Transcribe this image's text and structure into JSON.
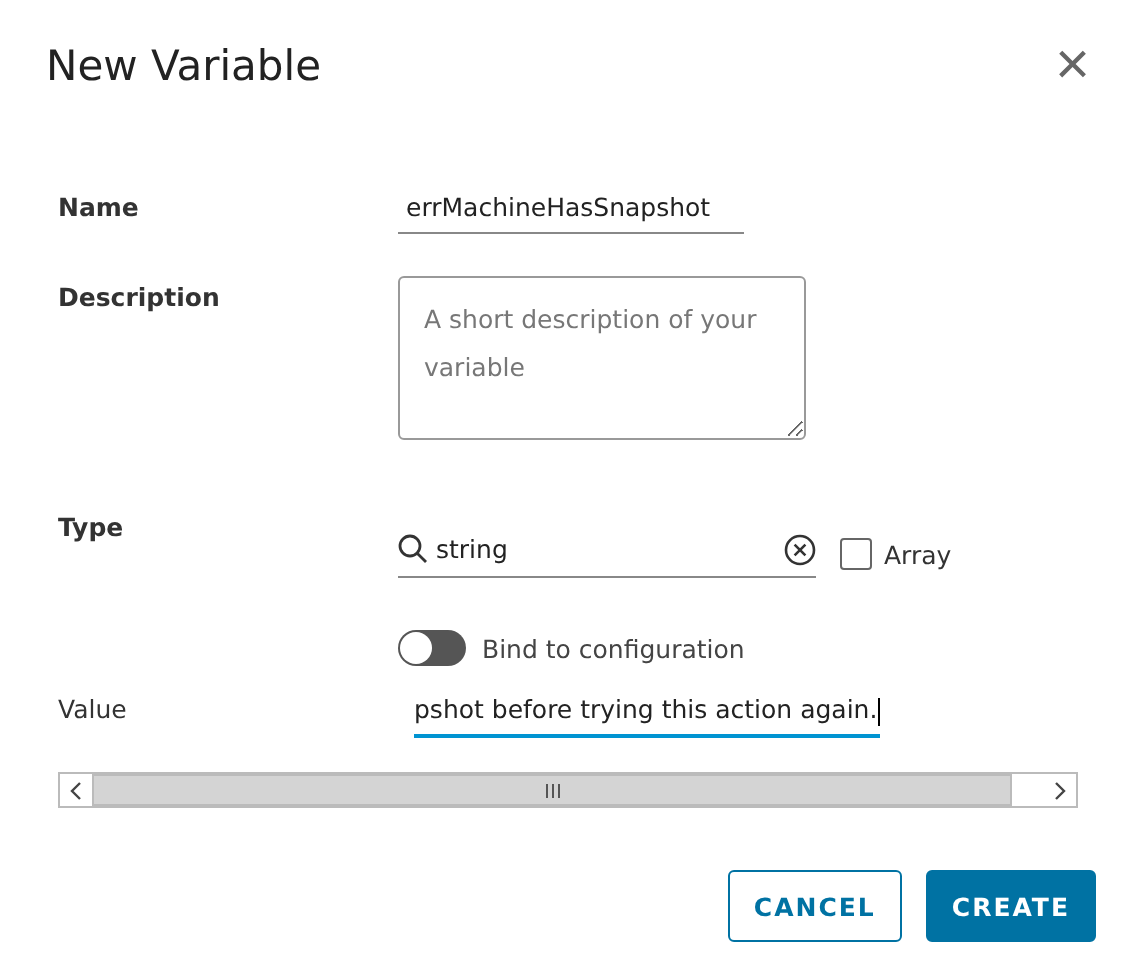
{
  "dialog": {
    "title": "New Variable",
    "close": "×"
  },
  "fields": [
    {
      "kind": "text",
      "label": "Name",
      "value": "errMachineHasSnapshot"
    },
    {
      "kind": "textarea",
      "label": "Description",
      "placeholder": "A short description of your variable"
    },
    {
      "kind": "search",
      "label": "Type",
      "value": "string",
      "checkbox": {
        "label": "Array",
        "checked": false
      }
    },
    {
      "kind": "toggle",
      "label": "Bind to configuration",
      "on": false
    },
    {
      "kind": "value",
      "label": "Value",
      "value": "pshot before trying this action again.",
      "focused": true
    }
  ],
  "buttons": [
    {
      "label": "CANCEL",
      "primary": false
    },
    {
      "label": "CREATE",
      "primary": true
    }
  ]
}
